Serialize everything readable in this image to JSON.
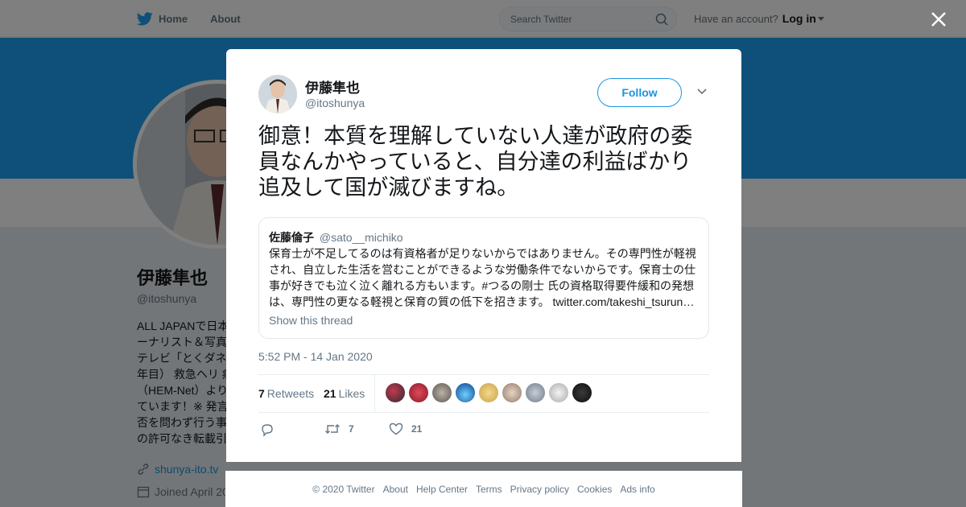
{
  "colors": {
    "accent": "#1da1f2",
    "link": "#1b95e0",
    "overlay": "rgba(0,0,0,0.5)"
  },
  "topnav": {
    "home_label": "Home",
    "about_label": "About",
    "search_placeholder": "Search Twitter",
    "account_prompt": "Have an account?",
    "login_label": "Log in",
    "icons": [
      "twitter-bird-icon",
      "search-icon",
      "chevron-down-icon"
    ]
  },
  "profile": {
    "name": "伊藤隼也",
    "handle": "@itoshunya",
    "bio_lines": [
      "ALL JAPANで日本",
      "ーナリスト＆写真",
      "テレビ「とくダネ",
      "年目） 救急ヘリ 病",
      "（HEM-Net）より",
      "ています！※ 発言",
      "否を問わず行う事",
      "の許可なき転載引"
    ],
    "website": "shunya-ito.tv",
    "joined": "Joined April 20"
  },
  "modal": {
    "author_name": "伊藤隼也",
    "author_handle": "@itoshunya",
    "follow_label": "Follow",
    "tweet_text": "御意！本質を理解していない人達が政府の委員なんかやっていると、自分達の利益ばかり追及して国が滅びますね。",
    "quote": {
      "name": "佐藤倫子",
      "handle": "@sato__michiko",
      "lines": [
        "保育士が不足してるのは有資格者が足りないからではありません。その専門性が軽視",
        "され、自立した生活を営むことができるような労働条件でないからです。保育士の仕",
        "事が好きでも泣く泣く離れる方もいます。#つるの剛士 氏の資格取得要件緩和の発想",
        "は、専門性の更なる軽視と保育の質の低下を招きます。 twitter.com/takeshi_tsurun…"
      ],
      "show_thread": "Show this thread"
    },
    "timestamp": "5:52 PM - 14 Jan 2020",
    "retweets_count": "7",
    "retweets_label": "Retweets",
    "likes_count": "21",
    "likes_label": "Likes",
    "actions": {
      "retweet_count": "7",
      "like_count": "21"
    },
    "icons": [
      "reply-icon",
      "retweet-icon",
      "heart-icon",
      "close-icon"
    ]
  },
  "footer": {
    "items": [
      "© 2020 Twitter",
      "About",
      "Help Center",
      "Terms",
      "Privacy policy",
      "Cookies",
      "Ads info"
    ]
  }
}
